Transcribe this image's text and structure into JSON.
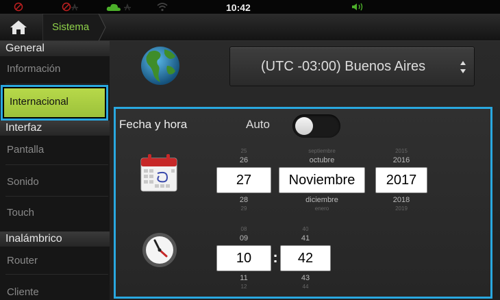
{
  "status_bar": {
    "time": "10:42"
  },
  "nav": {
    "breadcrumb": "Sistema"
  },
  "sidebar": {
    "sections": [
      {
        "title": "General",
        "items": [
          "Información",
          "Internacional"
        ]
      },
      {
        "title": "Interfaz",
        "items": [
          "Pantalla",
          "Sonido",
          "Touch"
        ]
      },
      {
        "title": "Inalámbrico",
        "items": [
          "Router",
          "Cliente"
        ]
      }
    ],
    "selected": "Internacional"
  },
  "timezone": {
    "value": "(UTC -03:00) Buenos Aires"
  },
  "datetime": {
    "title": "Fecha y hora",
    "auto_label": "Auto",
    "auto_enabled": false,
    "day": {
      "far_prev": "25",
      "prev": "26",
      "value": "27",
      "next": "28",
      "far_next": "29"
    },
    "month": {
      "far_prev": "septiembre",
      "prev": "octubre",
      "value": "Noviembre",
      "next": "diciembre",
      "far_next": "enero"
    },
    "year": {
      "far_prev": "2015",
      "prev": "2016",
      "value": "2017",
      "next": "2018",
      "far_next": "2019"
    },
    "hour": {
      "far_prev": "08",
      "prev": "09",
      "value": "10",
      "next": "11",
      "far_next": "12"
    },
    "minute": {
      "far_prev": "40",
      "prev": "41",
      "value": "42",
      "next": "43",
      "far_next": "44"
    },
    "time_separator": ":"
  },
  "colors": {
    "accent_blue": "#29a8e0",
    "selected_green": "#a9cf3f",
    "breadcrumb_green": "#8fd24a"
  }
}
